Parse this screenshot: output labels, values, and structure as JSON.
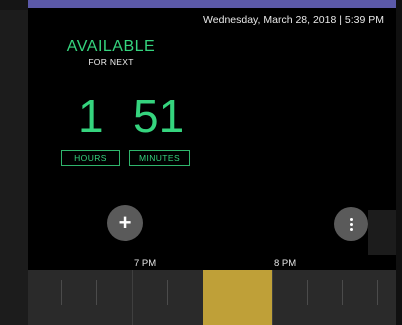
{
  "header": {
    "datetime": "Wednesday, March 28, 2018 | 5:39 PM"
  },
  "status": {
    "title": "AVAILABLE",
    "subtitle": "FOR NEXT",
    "hours_value": "1",
    "minutes_value": "51",
    "hours_label": "HOURS",
    "minutes_label": "MINUTES"
  },
  "actions": {
    "add_icon": "+",
    "more_icon": "more-vertical"
  },
  "timeline": {
    "labels": [
      "7 PM",
      "8 PM"
    ],
    "booked_color": "#bfa038"
  },
  "colors": {
    "accent": "#35d47e",
    "screen": "#000000",
    "bezel": "#5b59a8"
  }
}
